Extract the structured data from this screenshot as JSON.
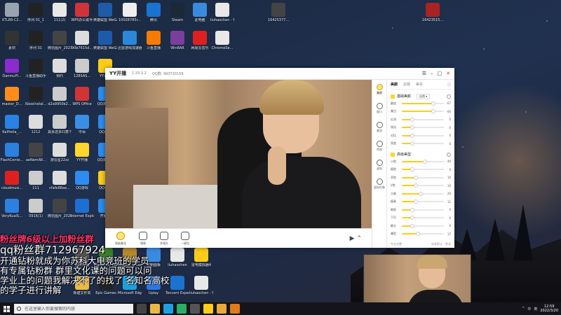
{
  "desktop": {
    "icons": [
      {
        "label": "XTL88-C2...",
        "color": "#9aa3b0"
      },
      {
        "label": "序列 01_1",
        "color": "#222"
      },
      {
        "label": "111(2)",
        "color": "#e8e8e8"
      },
      {
        "label": "WPS办公助手",
        "color": "#d13438"
      },
      {
        "label": "英雄联盟 WeGame版",
        "color": "#1f5aa8"
      },
      {
        "label": "10028785r...",
        "color": "#eee"
      },
      {
        "label": "腾讯",
        "color": "#1b73d1"
      },
      {
        "label": "Steam",
        "color": "#1b2838"
      },
      {
        "label": "此电脑",
        "color": "#3a8be0"
      },
      {
        "label": "liuhaochen - 快捷方式 (2)",
        "color": "#e8e8e8"
      },
      {
        "label": "16425377...",
        "color": "#444"
      },
      {
        "label": "16423515...",
        "color": "#a22"
      },
      {
        "label": "素材",
        "color": "#333"
      },
      {
        "label": "序列 01",
        "color": "#222"
      },
      {
        "label": "微信图片_2021102...",
        "color": "#444"
      },
      {
        "label": "90b7615d...",
        "color": "#ddd"
      },
      {
        "label": "英雄联盟 WeGame版",
        "color": "#1f5aa8"
      },
      {
        "label": "迅雷游戏加速器",
        "color": "#2b88d8"
      },
      {
        "label": "斗鱼直播",
        "color": "#f77b00"
      },
      {
        "label": "WinRAR",
        "color": "#7a3e9d"
      },
      {
        "label": "网易云音乐",
        "color": "#e02020"
      },
      {
        "label": "ChromeSe...",
        "color": "#e8e8e8"
      },
      {
        "label": "DanmuPl...",
        "color": "#8b2bd0"
      },
      {
        "label": "斗鱼直播助手",
        "color": "#222"
      },
      {
        "label": "预约",
        "color": "#ddd"
      },
      {
        "label": "128SAS...",
        "color": "#ccc"
      },
      {
        "label": "YY语音",
        "color": "#ffcc1a"
      },
      {
        "label": "master_D...",
        "color": "#ff8c1a"
      },
      {
        "label": "XboxInstal...",
        "color": "#222"
      },
      {
        "label": "d2a9950b2...",
        "color": "#ccc"
      },
      {
        "label": "WPS Office",
        "color": "#d13438"
      },
      {
        "label": "QQ浏览器",
        "color": "#2d8cf0"
      },
      {
        "label": "KaiHeila_...",
        "color": "#2a82e4"
      },
      {
        "label": "1212",
        "color": "#ddd"
      },
      {
        "label": "其余选多同意个性任何的...",
        "color": "#ccc"
      },
      {
        "label": "中佰",
        "color": "#3b8ee6"
      },
      {
        "label": "QQ游戏",
        "color": "#2d8cf0"
      },
      {
        "label": "FlashCente...",
        "color": "#2d7fe0"
      },
      {
        "label": "aeNemiW...",
        "color": "#444"
      },
      {
        "label": "游云星22zz",
        "color": "#ddd"
      },
      {
        "label": "YY开播",
        "color": "#ffd52e"
      },
      {
        "label": "QQ浏览器",
        "color": "#2d8cf0"
      },
      {
        "label": "cloudmusi...",
        "color": "#e02020"
      },
      {
        "label": "111",
        "color": "#ccc"
      },
      {
        "label": "cfafe88ae...",
        "color": "#ddd"
      },
      {
        "label": "QQ游戏",
        "color": "#2d8cf0"
      },
      {
        "label": "QQ音乐",
        "color": "#ffcc1a"
      },
      {
        "label": "VeryKuaiS...",
        "color": "#2d7fe0"
      },
      {
        "label": "0916(1)",
        "color": "#ccc"
      },
      {
        "label": "微信图片_2021111...",
        "color": "#444"
      },
      {
        "label": "Internet Explorer",
        "color": "#1e6fd1"
      },
      {
        "label": "开播端",
        "color": "#2d8cf0"
      }
    ],
    "window_icons": [
      {
        "label": "图片传输",
        "color": "#555"
      },
      {
        "label": "Plants vs. Zombies",
        "color": "#3a7d2a"
      },
      {
        "label": "League of Legends",
        "color": "#b48a2b"
      },
      {
        "label": "控制面板",
        "color": "#3a8be0"
      },
      {
        "label": "liuhaochen",
        "color": "#e8e8e8"
      },
      {
        "label": "雷电模拟器4",
        "color": "#ffcc1a"
      },
      {
        "label": "新建文件夹",
        "color": "#e8b84a"
      },
      {
        "label": "Epic Games",
        "color": "#222"
      },
      {
        "label": "Microsoft Edge",
        "color": "#1ba1e2"
      },
      {
        "label": "Uplay",
        "color": "#2b78e4"
      },
      {
        "label": "Tencent Experience",
        "color": "#1b73d1"
      },
      {
        "label": "liuhaochen - 快捷方式",
        "color": "#e8e8e8"
      }
    ]
  },
  "yy": {
    "logo": "YY开播",
    "version": "1.33.1.2",
    "qq": "QQ群: 993720159",
    "controls": {
      "settings": "☰",
      "minimize": "–",
      "maximize": "□",
      "close": "✕"
    },
    "toolbar": [
      {
        "label": "智能美化",
        "round": true
      },
      {
        "label": "镜像",
        "round": false
      },
      {
        "label": "多镜头",
        "round": false
      },
      {
        "label": "一键包",
        "round": false
      }
    ],
    "cam_toggle": "▶ ⌃",
    "sidebar": [
      {
        "label": "美颜",
        "active": true
      },
      {
        "label": "窗口",
        "active": false
      },
      {
        "label": "美妆",
        "active": false
      },
      {
        "label": "特效",
        "active": false
      },
      {
        "label": "虚拟",
        "active": false
      },
      {
        "label": "虚拟形象",
        "active": false
      }
    ],
    "panel": {
      "tabs": [
        "美颜",
        "滤镜",
        "美妆"
      ],
      "active_tab": 0,
      "section1": {
        "title": "基础美颜",
        "preset": "自然 ▾"
      },
      "sliders1": [
        {
          "name": "磨皮",
          "value": 67
        },
        {
          "name": "美白",
          "value": 66
        },
        {
          "name": "红润",
          "value": 0
        },
        {
          "name": "锐化",
          "value": 0
        },
        {
          "name": "对比",
          "value": 0
        },
        {
          "name": "亮度",
          "value": 0
        }
      ],
      "section2": {
        "title": "高级美型",
        "preset": ""
      },
      "sliders2": [
        {
          "name": "小脸",
          "value": 40
        },
        {
          "name": "瘦脸",
          "value": 0
        },
        {
          "name": "窄脸",
          "value": 10
        },
        {
          "name": "V脸",
          "value": 10
        },
        {
          "name": "大眼",
          "value": 26
        },
        {
          "name": "瘦鼻",
          "value": 11
        },
        {
          "name": "眼距",
          "value": 0
        },
        {
          "name": "下巴",
          "value": 0
        },
        {
          "name": "额头",
          "value": 0
        },
        {
          "name": "嘴型",
          "value": 17
        }
      ],
      "footer_left": "专业设置",
      "footer_right": "恢复默认 · 更多"
    }
  },
  "overlay": {
    "fans_line": "粉丝牌6级以上加粉丝群",
    "qq_line": "qq粉丝群712967924",
    "line3": "开通钻粉就成为你苏科大电竞班的学员",
    "line4": "有专属钻粉群 群里文化课的问题可以问",
    "line5": "学业上的问题我解决不了的找了 名知名高校",
    "line6": "的学子进行讲解"
  },
  "taskbar": {
    "search_placeholder": "在这里输入你要搜索的内容",
    "apps": [
      {
        "name": "task-view",
        "color": "#444"
      },
      {
        "name": "explorer",
        "color": "#e8b84a"
      },
      {
        "name": "edge",
        "color": "#1ba1e2"
      },
      {
        "name": "wechat",
        "color": "#2aae67"
      },
      {
        "name": "obs",
        "color": "#555"
      },
      {
        "name": "yy",
        "color": "#ffcc1a"
      },
      {
        "name": "folder",
        "color": "#e8a93a"
      },
      {
        "name": "app",
        "color": "#e07b1a"
      }
    ],
    "tray": [
      "^",
      "中",
      "英"
    ],
    "time": "12:59",
    "date": "2022/3/20"
  }
}
